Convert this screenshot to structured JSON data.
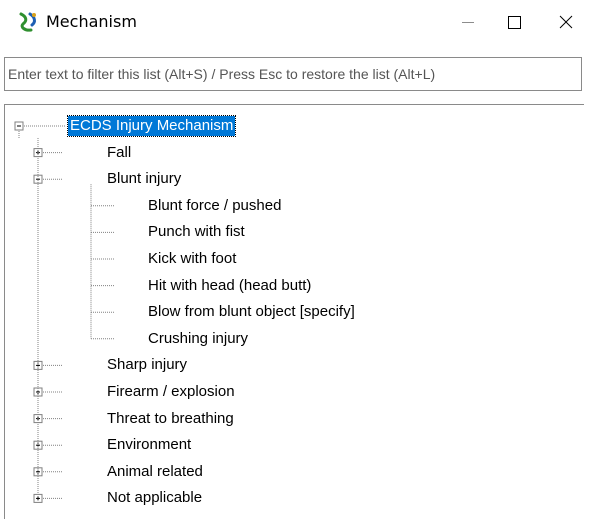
{
  "window": {
    "title": "Mechanism",
    "icon": "mechanism-app-icon",
    "controls": {
      "minimize": "minimize-icon",
      "maximize": "maximize-icon",
      "close": "close-icon"
    }
  },
  "filter": {
    "placeholder": "Enter text to filter this list (Alt+S) / Press Esc to restore the list (Alt+L)",
    "value": ""
  },
  "tree": {
    "root": {
      "label": "ECDS Injury Mechanism",
      "expanded": true,
      "selected": true
    },
    "items": [
      {
        "label": "Fall",
        "expanded": false
      },
      {
        "label": "Blunt injury",
        "expanded": true,
        "children": [
          "Blunt force / pushed",
          "Punch with fist",
          "Kick with foot",
          "Hit with head (head butt)",
          "Blow from blunt object [specify]",
          "Crushing injury"
        ]
      },
      {
        "label": "Sharp injury",
        "expanded": false
      },
      {
        "label": "Firearm / explosion",
        "expanded": false
      },
      {
        "label": "Threat to breathing",
        "expanded": false
      },
      {
        "label": "Environment",
        "expanded": false
      },
      {
        "label": "Animal related",
        "expanded": false
      },
      {
        "label": "Not applicable",
        "expanded": false
      }
    ]
  },
  "colors": {
    "selection": "#0078d7",
    "border": "#8a8a8a",
    "tree_lines": "#808080"
  }
}
